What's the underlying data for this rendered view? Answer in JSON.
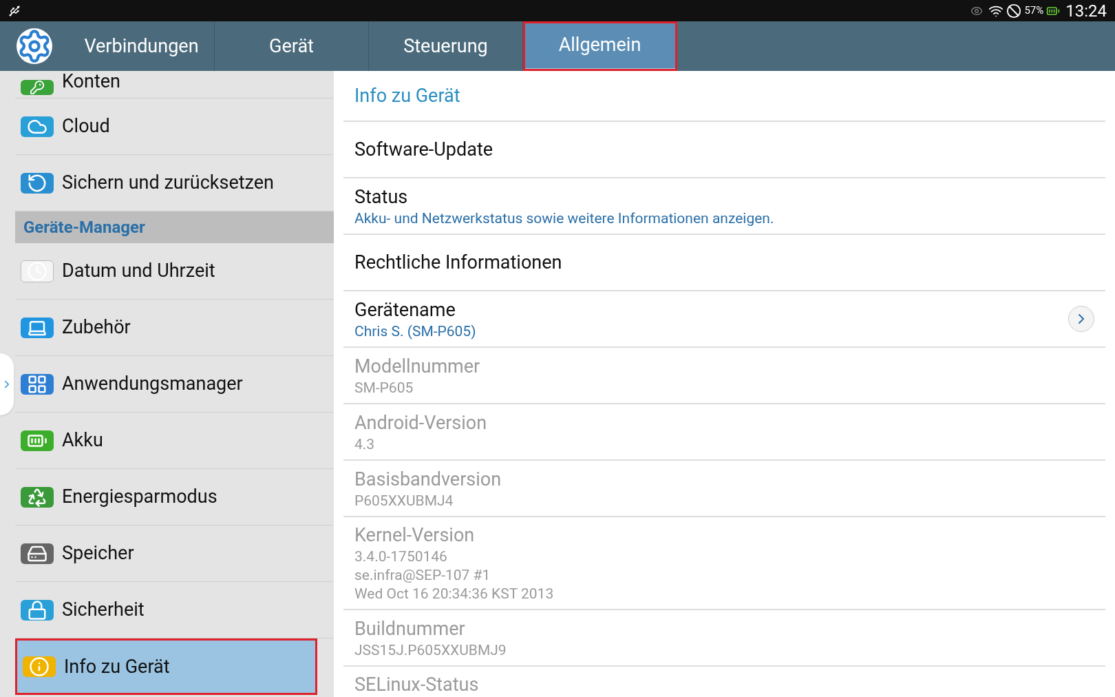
{
  "status_bar": {
    "battery": "57%",
    "time": "13:24"
  },
  "tabs": [
    {
      "label": "Verbindungen",
      "selected": false
    },
    {
      "label": "Gerät",
      "selected": false
    },
    {
      "label": "Steuerung",
      "selected": false
    },
    {
      "label": "Allgemein",
      "selected": true
    }
  ],
  "sidebar": {
    "items": [
      {
        "kind": "item",
        "label": "Konten",
        "selected": false
      },
      {
        "kind": "item",
        "label": "Cloud",
        "selected": false
      },
      {
        "kind": "item",
        "label": "Sichern und zurücksetzen",
        "selected": false
      },
      {
        "kind": "header",
        "label": "Geräte-Manager"
      },
      {
        "kind": "item",
        "label": "Datum und Uhrzeit",
        "selected": false
      },
      {
        "kind": "item",
        "label": "Zubehör",
        "selected": false
      },
      {
        "kind": "item",
        "label": "Anwendungsmanager",
        "selected": false
      },
      {
        "kind": "item",
        "label": "Akku",
        "selected": false
      },
      {
        "kind": "item",
        "label": "Energiesparmodus",
        "selected": false
      },
      {
        "kind": "item",
        "label": "Speicher",
        "selected": false
      },
      {
        "kind": "item",
        "label": "Sicherheit",
        "selected": false
      },
      {
        "kind": "item",
        "label": "Info zu Gerät",
        "selected": true
      }
    ]
  },
  "detail": {
    "title": "Info zu Gerät",
    "rows": [
      {
        "title": "Software-Update",
        "disabled": false
      },
      {
        "title": "Status",
        "summary": [
          "Akku- und Netzwerkstatus sowie weitere Informationen anzeigen."
        ],
        "disabled": false
      },
      {
        "title": "Rechtliche Informationen",
        "disabled": false
      },
      {
        "title": "Gerätename",
        "summary": [
          "Chris S. (SM-P605)"
        ],
        "disabled": false,
        "chevron": true
      },
      {
        "title": "Modellnummer",
        "summary": [
          "SM-P605"
        ],
        "disabled": true
      },
      {
        "title": "Android-Version",
        "summary": [
          "4.3"
        ],
        "disabled": true
      },
      {
        "title": "Basisbandversion",
        "summary": [
          "P605XXUBMJ4"
        ],
        "disabled": true
      },
      {
        "title": "Kernel-Version",
        "summary": [
          "3.4.0-1750146",
          "se.infra@SEP-107 #1",
          "Wed Oct 16 20:34:36 KST 2013"
        ],
        "disabled": true
      },
      {
        "title": "Buildnummer",
        "summary": [
          "JSS15J.P605XXUBMJ9"
        ],
        "disabled": true
      },
      {
        "title": "SELinux-Status",
        "disabled": true
      }
    ]
  }
}
